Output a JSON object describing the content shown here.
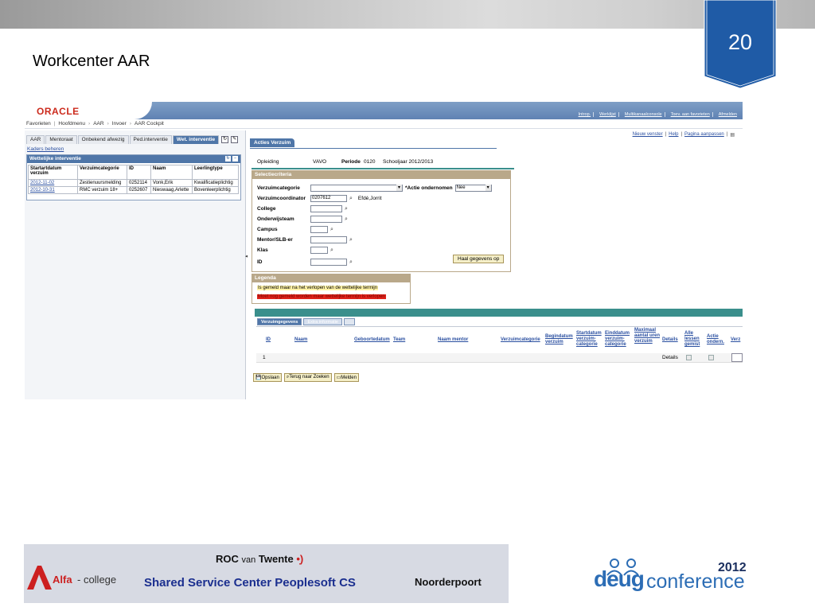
{
  "slide": {
    "number": "20",
    "title": "Workcenter AAR"
  },
  "app": {
    "brand": "ORACLE",
    "top_links": [
      "Introp.",
      "Werklijst",
      "Multikanaalconsole",
      "Toev. aan favorieten",
      "Afmelden"
    ],
    "breadcrumb": [
      "Favorieten",
      "Hoofdmenu",
      "AAR",
      "Invoer",
      "AAR Cockpit"
    ]
  },
  "left": {
    "tabs": [
      "AAR",
      "Mentoraat",
      "Onbekend afwezig",
      "Ped.interventie",
      "Wet. interventie"
    ],
    "kaders_link": "Kaders beheren",
    "panel_title": "Wettelijke interventie",
    "columns": [
      "Startartdatum verzuim",
      "Verzuimcategorie",
      "ID",
      "Naam",
      "Leerlingtype"
    ],
    "rows": [
      [
        "2012-11-02",
        "Zestienuursmelding",
        "0252114",
        "Vonk,Erik",
        "Kwalificatieplichtig"
      ],
      [
        "2012-10-31",
        "RMC verzuim 18+",
        "0252607",
        "Nieswaag,Arlette",
        "Bovenleerplichtig"
      ]
    ]
  },
  "right": {
    "links": [
      "Nieuw venster",
      "Help",
      "Pagina aanpassen"
    ],
    "tab": "Acties Verzuim",
    "opleiding_label": "Opleiding",
    "opleiding_value": "VAVO",
    "periode_label": "Periode",
    "periode_value": "0120",
    "periode_desc": "Schooljaar 2012/2013",
    "selectie_title": "Selectiecriteria",
    "fields": {
      "verzuimcategorie": "Verzuimcategorie",
      "actie_label": "*Actie ondernomen",
      "actie_value": "Nee",
      "coordinator": "Verzuimcoordinator",
      "coordinator_value": "0207612",
      "coordinator_name": "Efdé,Jorrit",
      "college": "College",
      "onderwijsteam": "Onderwijsteam",
      "campus": "Campus",
      "mentor": "Mentor/SLB-er",
      "klas": "Klas",
      "id": "ID"
    },
    "haal_button": "Haal gegevens op",
    "legenda_title": "Legenda",
    "legenda_1": "Is gemeld maar na het verlopen van de wettelijke termijn",
    "legenda_2": "Moet nog gemeld worden maar wettelijke termijn is verlopen",
    "grid_tabs": [
      "Verzuimgegevens",
      "Extra informatie"
    ],
    "grid_columns": [
      "ID",
      "Naam",
      "Geboortedatum",
      "Team",
      "Naam mentor",
      "Verzuimcategorie",
      "Begindatum verzuim",
      "Startdatum verzuim-categorie",
      "Einddatum verzuim-categorie",
      "Maximaal aantal uren verzuim",
      "Details",
      "Alle lessen gemist",
      "Actie ondern.",
      "Verz"
    ],
    "row_num": "1",
    "row_details": "Details",
    "buttons": [
      "Opslaan",
      "Terug naar Zoeken",
      "Melden"
    ]
  },
  "logos": {
    "alfa": "Alfa",
    "alfa_college": "- college",
    "roc": "ROC",
    "roc_van": "van",
    "roc_twente": "Twente",
    "ssc": "Shared Service Center Peoplesoft CS",
    "noorderpoort": "Noorderpoort",
    "deug": "deug",
    "conference": "conference",
    "year": "2012"
  },
  "colors": {
    "accent_blue": "#1f5ba6",
    "panel_blue": "#4f76a8",
    "teal": "#3a8f8c",
    "tan": "#b9a88a",
    "legend_yellow": "#fff3a8",
    "legend_red": "#e1231b"
  }
}
